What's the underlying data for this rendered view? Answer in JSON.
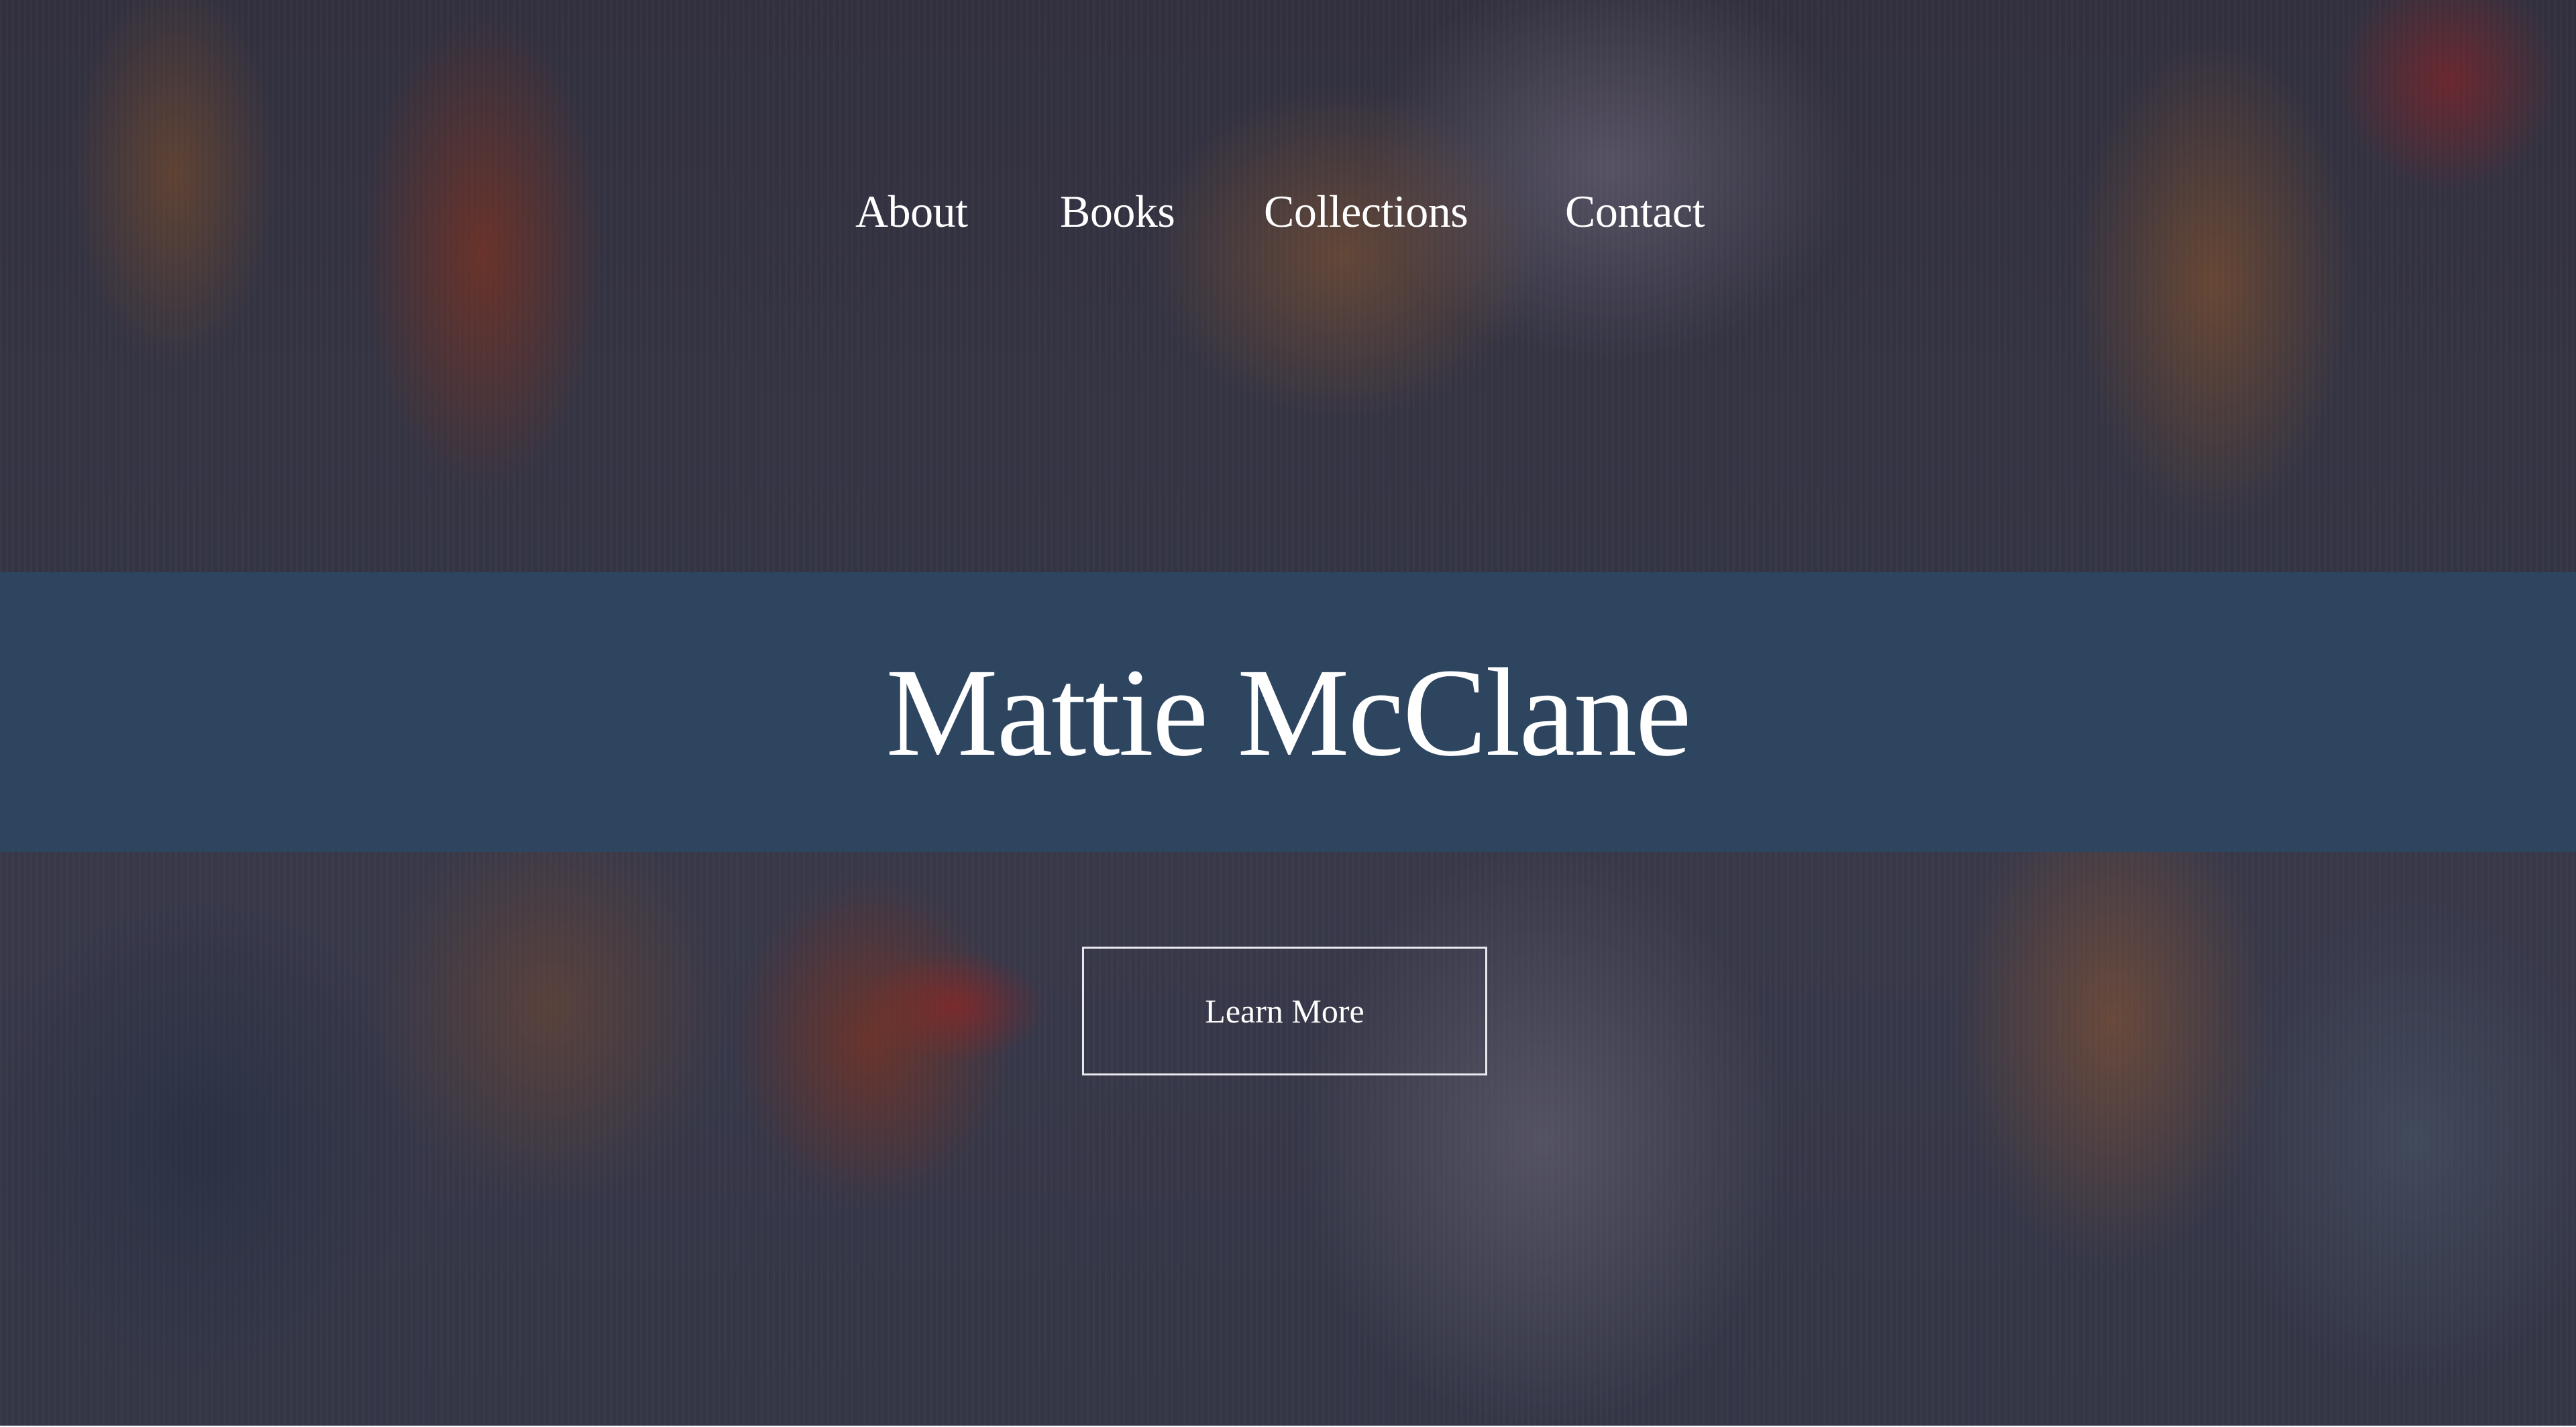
{
  "nav": {
    "items": [
      {
        "label": "About"
      },
      {
        "label": "Books"
      },
      {
        "label": "Collections"
      },
      {
        "label": "Contact"
      }
    ]
  },
  "hero": {
    "title": "Mattie McClane",
    "cta_label": "Learn More",
    "band_color": "#2e4560",
    "background": "abstract painting (rust, ochre, slate blue)"
  }
}
